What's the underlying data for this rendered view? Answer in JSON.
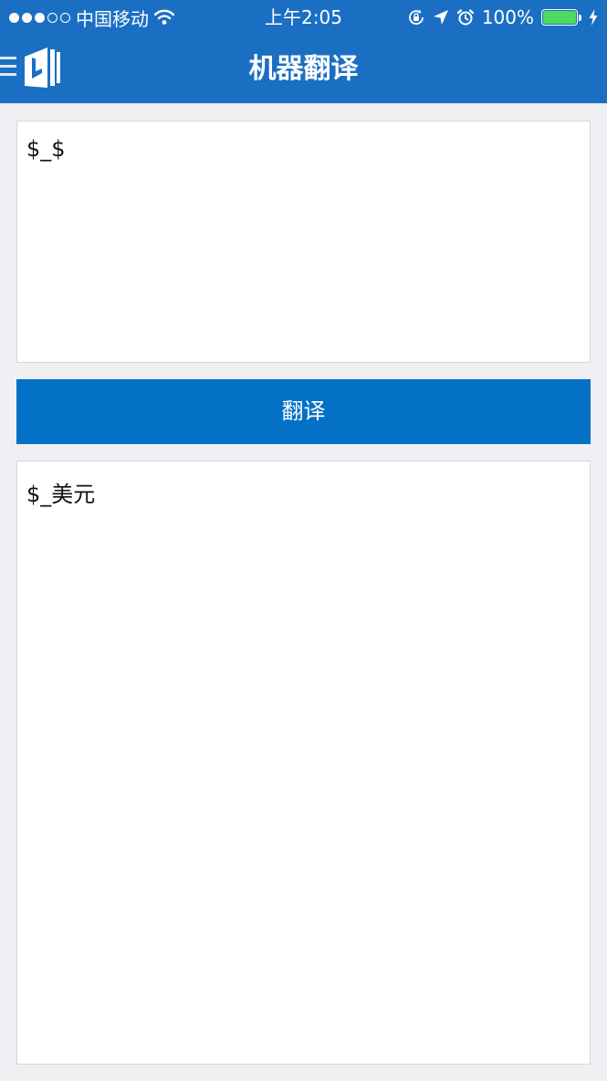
{
  "status_bar": {
    "carrier": "中国移动",
    "time": "上午2:05",
    "battery": "100%",
    "battery_level": 1.0,
    "icons": [
      "signal-dots-icon",
      "wifi-icon",
      "orientation-lock-icon",
      "location-arrow-icon",
      "alarm-icon",
      "battery-icon",
      "charging-bolt-icon"
    ]
  },
  "header": {
    "title": "机器翻译",
    "menu_icon": "hamburger-menu-icon",
    "logo_icon": "bing-translator-logo-icon"
  },
  "source": {
    "text": "$_$"
  },
  "translate_button": {
    "label": "翻译"
  },
  "result": {
    "text": "$_美元"
  },
  "colors": {
    "header_bg": "#1b6fc3",
    "button_bg": "#0271c6",
    "page_bg": "#efeff4",
    "battery_green": "#4cd964"
  }
}
